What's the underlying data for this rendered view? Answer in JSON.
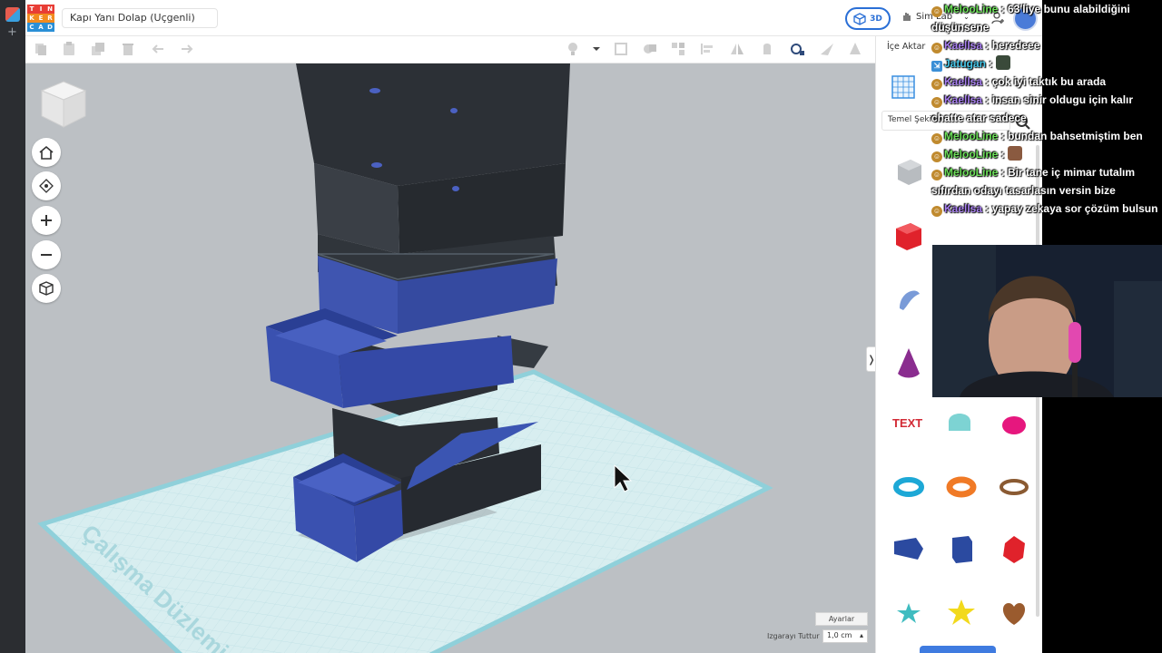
{
  "app": {
    "logo_letters": [
      "T",
      "I",
      "N",
      "K",
      "E",
      "R",
      "C",
      "A",
      "D"
    ],
    "design_name": "Kapı Yanı Dolap (Uçgenli)",
    "mode_label": "3D",
    "simlab_label": "Sim Lab",
    "accent": "#2a6fd6"
  },
  "rpanel": {
    "import_label": "İçe Aktar",
    "library_select": "Temel Şekiller",
    "shapes": [
      {
        "name": "box-hole",
        "color": "#b8bcc0"
      },
      {
        "name": "box",
        "color": "#e0222b"
      },
      {
        "name": "scribble",
        "color": "#7a9bd8"
      },
      {
        "name": "cone",
        "color": "#8a2d8f"
      },
      {
        "name": "text",
        "color": "#d22a35"
      },
      {
        "name": "half-cylinder",
        "color": "#7dd3d3"
      },
      {
        "name": "half-sphere",
        "color": "#e6177e"
      },
      {
        "name": "torus",
        "color": "#1da8d6"
      },
      {
        "name": "ring-orange",
        "color": "#f07a26"
      },
      {
        "name": "tube",
        "color": "#8a5a32"
      },
      {
        "name": "wedge",
        "color": "#2b4aa0"
      },
      {
        "name": "hexagonal-prism",
        "color": "#2b4aa0"
      },
      {
        "name": "polyhedron",
        "color": "#e0222b"
      },
      {
        "name": "star-teal",
        "color": "#3fbcc0"
      },
      {
        "name": "star-yellow",
        "color": "#f2d91c"
      },
      {
        "name": "heart",
        "color": "#9a5b2e"
      }
    ]
  },
  "viewport": {
    "workplane_text": "Çalışma Düzlemi",
    "settings_label": "Ayarlar",
    "snap_label": "Izgarayı Tuttur",
    "snap_value": "1,0 cm",
    "panel_toggle": "❭"
  },
  "chat": [
    {
      "user": "MelooLine",
      "color": "green",
      "text": "63'liye bunu alabildiğini düşünsene"
    },
    {
      "user": "Kaellsa",
      "color": "purple",
      "text": "heredeee"
    },
    {
      "user": "Jatugan",
      "color": "teal",
      "text": "",
      "emote": "cat",
      "badge": "blue"
    },
    {
      "user": "Kaellsa",
      "color": "purple",
      "text": "çok iyi taktık bu arada"
    },
    {
      "user": "Kaellsa",
      "color": "purple",
      "text": "insan sinir oldugu için kalır chatte atar sadece"
    },
    {
      "user": "MelooLine",
      "color": "green",
      "text": "bundan bahsetmiştim ben"
    },
    {
      "user": "MelooLine",
      "color": "green",
      "text": "",
      "emote": "face"
    },
    {
      "user": "MelooLine",
      "color": "green",
      "text": "Bir tane iç mimar tutalım sıfırdan odayı tasarlasın versin bize"
    },
    {
      "user": "Kaellsa",
      "color": "purple",
      "text": "yapay zekaya sor çözüm bulsun"
    }
  ]
}
